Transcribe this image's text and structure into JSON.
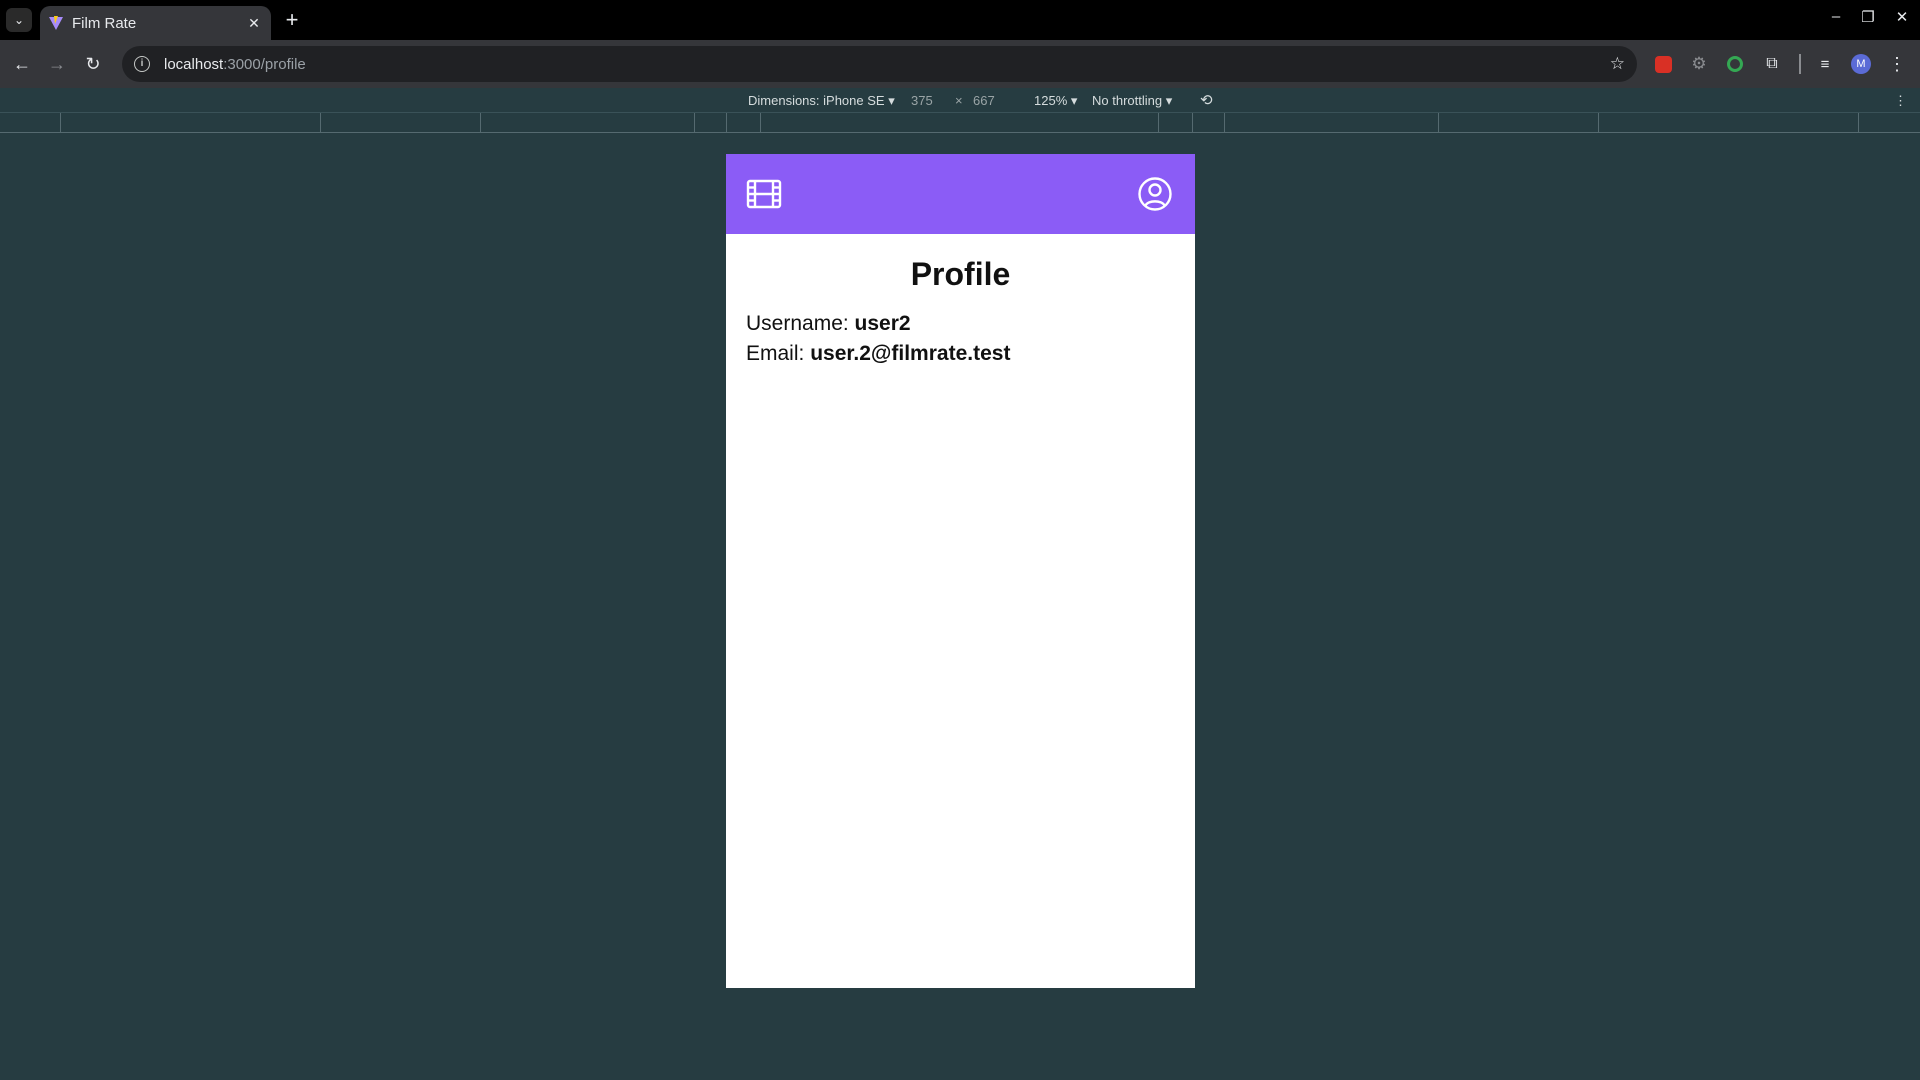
{
  "browser": {
    "tab_title": "Film Rate",
    "url_host": "localhost",
    "url_path": ":3000/profile",
    "profile_initial": "M"
  },
  "devtools": {
    "dimensions_label": "Dimensions: iPhone SE",
    "width": "375",
    "times": "×",
    "height": "667",
    "zoom": "125%",
    "throttling": "No throttling"
  },
  "app": {
    "accent_color": "#8b5cf6",
    "logo_icon": "film-icon",
    "account_icon": "user-circle-icon"
  },
  "profile": {
    "title": "Profile",
    "username_label": "Username:",
    "username_value": "user2",
    "email_label": "Email:",
    "email_value": "user.2@filmrate.test"
  }
}
